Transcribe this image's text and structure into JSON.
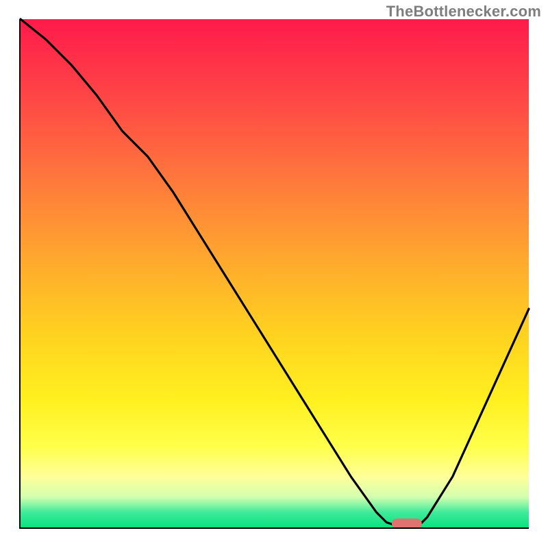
{
  "attribution": "TheBottlenecker.com",
  "chart_data": {
    "type": "line",
    "title": "",
    "xlabel": "",
    "ylabel": "",
    "xlim": [
      0,
      100
    ],
    "ylim": [
      0,
      100
    ],
    "x": [
      0,
      5,
      10,
      15,
      20,
      25,
      30,
      35,
      40,
      45,
      50,
      55,
      60,
      65,
      70,
      72,
      75,
      78,
      80,
      85,
      90,
      95,
      100
    ],
    "values": [
      100,
      96,
      91,
      85,
      78,
      73,
      66,
      58,
      50,
      42,
      34,
      26,
      18,
      10,
      3,
      1,
      0,
      0,
      2,
      10,
      21,
      32,
      43
    ],
    "marker": {
      "x": 76,
      "y": 0
    },
    "colors": {
      "curve": "#000000",
      "marker": "#e0726f",
      "gradient_top": "#ff1a4a",
      "gradient_bottom": "#09e27f"
    }
  }
}
